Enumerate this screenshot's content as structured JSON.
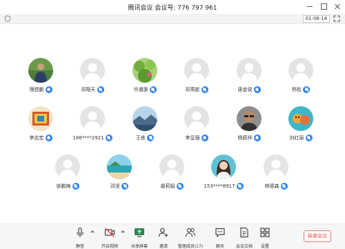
{
  "window": {
    "title": "腾讯会议  会议号: 776 797 961"
  },
  "meeting": {
    "timer": "01:06:14"
  },
  "participants": [
    {
      "name": "理想鹏",
      "avatar": "photo-man-green",
      "mic": "active"
    },
    {
      "name": "邓翔天",
      "avatar": "default",
      "mic": "muted"
    },
    {
      "name": "许湘莲",
      "avatar": "photo-plants",
      "mic": "muted"
    },
    {
      "name": "邓燕妮",
      "avatar": "default",
      "mic": "muted"
    },
    {
      "name": "唐金锐",
      "avatar": "default",
      "mic": "active"
    },
    {
      "name": "熊松",
      "avatar": "default",
      "mic": "muted"
    },
    {
      "name": "李志宏",
      "avatar": "photo-colorful",
      "mic": "active"
    },
    {
      "name": "186****2921",
      "avatar": "default",
      "mic": "muted"
    },
    {
      "name": "王栋",
      "avatar": "photo-landscape",
      "mic": "muted"
    },
    {
      "name": "李显强",
      "avatar": "default",
      "mic": "active"
    },
    {
      "name": "杨佩祥",
      "avatar": "photo-man-glasses",
      "mic": "active"
    },
    {
      "name": "刘红丽",
      "avatar": "photo-cartoon",
      "mic": "muted"
    },
    {
      "name": "徐鹏梅",
      "avatar": "default",
      "mic": "muted"
    },
    {
      "name": "邓坚",
      "avatar": "photo-beach",
      "mic": "muted"
    },
    {
      "name": "虞莉娟",
      "avatar": "default",
      "mic": "muted"
    },
    {
      "name": "153****8917",
      "avatar": "photo-woman",
      "mic": "muted"
    },
    {
      "name": "林德森",
      "avatar": "default",
      "mic": "muted"
    }
  ],
  "toolbar": {
    "mute_label": "静音",
    "video_label": "开启视频",
    "share_label": "共享屏幕",
    "invite_label": "邀请",
    "members_label": "管理成员(17)",
    "chat_label": "聊天",
    "docs_label": "会议文档",
    "settings_label": "设置",
    "end_label": "结束会议"
  },
  "colors": {
    "mic_badge": "#2c83f5",
    "end_button": "#e44444",
    "background": "#ffffff"
  }
}
